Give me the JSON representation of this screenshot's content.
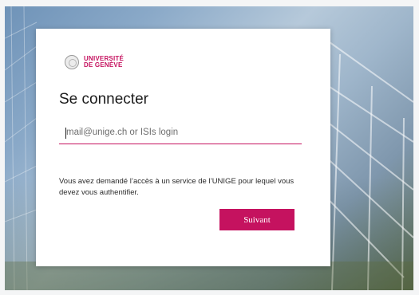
{
  "login": {
    "logo": {
      "line1": "UNIVERSITÉ",
      "line2": "DE GENÈVE"
    },
    "title": "Se connecter",
    "username_placeholder": "mail@unige.ch or ISIs login",
    "username_value": "",
    "info_text": "Vous avez demandé l’accès à un service de l’UNIGE pour lequel vous devez vous authentifier.",
    "next_label": "Suivant"
  },
  "colors": {
    "accent": "#c5125f",
    "card": "#ffffff"
  },
  "icons": {
    "logo_seal": "university-seal-icon"
  }
}
